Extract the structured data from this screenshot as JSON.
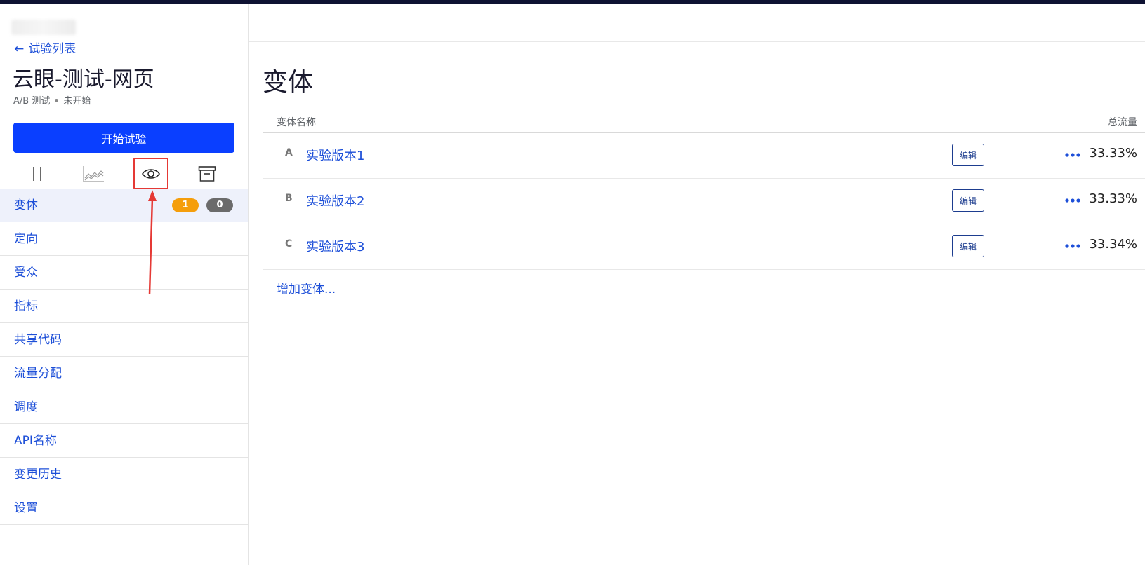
{
  "sidebar": {
    "back_label": "试验列表",
    "back_arrow": "←",
    "experiment_title": "云眼-测试-网页",
    "experiment_type": "A/B 测试",
    "experiment_status": "未开始",
    "start_button": "开始试验",
    "toolbar_icons": [
      "pause-icon",
      "chart-icon",
      "eye-icon",
      "archive-icon"
    ],
    "nav": [
      {
        "label": "变体",
        "active": true,
        "badge_orange": "1",
        "badge_gray": "0"
      },
      {
        "label": "定向"
      },
      {
        "label": "受众"
      },
      {
        "label": "指标"
      },
      {
        "label": "共享代码"
      },
      {
        "label": "流量分配"
      },
      {
        "label": "调度"
      },
      {
        "label": "API名称"
      },
      {
        "label": "变更历史"
      },
      {
        "label": "设置"
      }
    ]
  },
  "main": {
    "title": "变体",
    "columns": {
      "name": "变体名称",
      "traffic": "总流量"
    },
    "rows": [
      {
        "letter": "A",
        "name": "实验版本1",
        "traffic": "33.33%",
        "edit": "编辑"
      },
      {
        "letter": "B",
        "name": "实验版本2",
        "traffic": "33.33%",
        "edit": "编辑"
      },
      {
        "letter": "C",
        "name": "实验版本3",
        "traffic": "33.34%",
        "edit": "编辑"
      }
    ],
    "add_variant": "增加变体..."
  },
  "colors": {
    "primary": "#0a3fff",
    "link": "#1d4fd8",
    "badge_orange": "#f59e0b",
    "badge_gray": "#6b6b6b",
    "annotation_red": "#e53935",
    "topbar": "#0e1232"
  }
}
